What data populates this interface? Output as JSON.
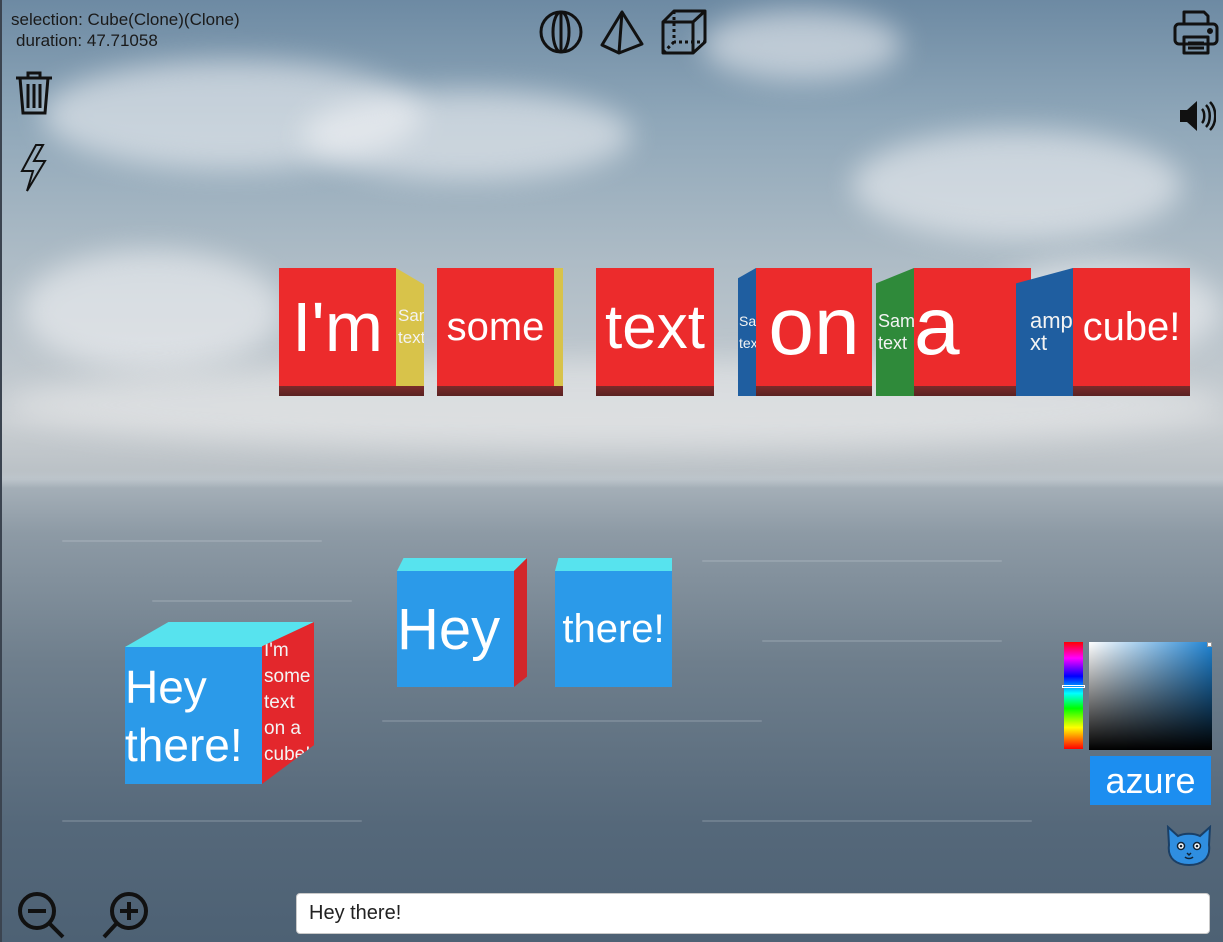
{
  "hud": {
    "selection_label": "selection: Cube(Clone)(Clone)",
    "duration_label": "duration: 47.71058"
  },
  "toolbar": {
    "icons": [
      "trash-icon",
      "lightning-icon",
      "sphere-icon",
      "pyramid-icon",
      "cube-icon",
      "printer-icon",
      "speaker-icon",
      "zoom-out-icon",
      "zoom-in-icon",
      "cat-icon"
    ]
  },
  "cubes_top_row": [
    {
      "front": "I'm",
      "side": [
        "Sample",
        "text"
      ],
      "side_color": "#d9c64a"
    },
    {
      "front": "some",
      "side": [],
      "side_color": "#d9c64a"
    },
    {
      "front": "text",
      "side": [],
      "side_color": "#d9c64a"
    },
    {
      "front": "on",
      "left_side": [
        "Sample",
        "text"
      ],
      "side_color": "#1f5ea0"
    },
    {
      "front": "a",
      "left_side": [
        "Sample",
        "text"
      ],
      "side_color": "#2f8a3a"
    },
    {
      "front": "cube!",
      "left_side": [
        "ample",
        "xt"
      ],
      "side_color": "#1f5ea0"
    }
  ],
  "cubes_bottom": [
    {
      "front": "Hey there!",
      "side": [
        "I'm some",
        "text on a",
        "cube!"
      ]
    },
    {
      "front": "Hey",
      "side": []
    },
    {
      "front": "there!",
      "side": []
    }
  ],
  "color_picker": {
    "selected_name": "azure",
    "accent": "#1c8ef0"
  },
  "text_input": {
    "value": "Hey there!"
  }
}
